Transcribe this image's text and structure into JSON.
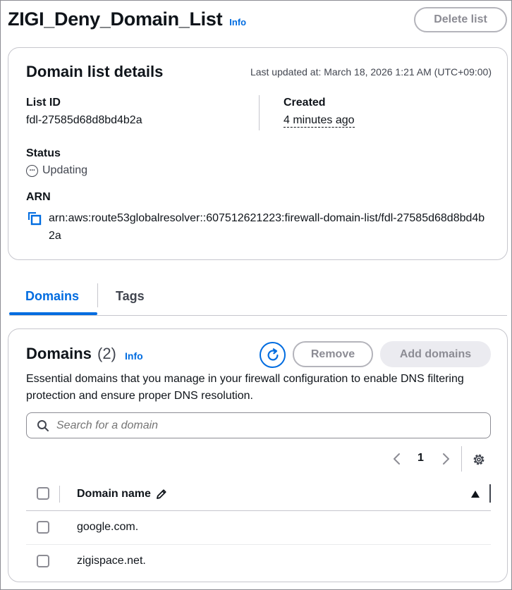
{
  "header": {
    "title": "ZIGI_Deny_Domain_List",
    "info_label": "Info",
    "delete_label": "Delete list"
  },
  "details": {
    "title": "Domain list details",
    "last_updated": "Last updated at: March 18, 2026 1:21 AM (UTC+09:00)",
    "list_id_label": "List ID",
    "list_id_value": "fdl-27585d68d8bd4b2a",
    "created_label": "Created",
    "created_value": "4 minutes ago",
    "status_label": "Status",
    "status_value": "Updating",
    "status_icon": "ellipsis-circle-icon",
    "arn_label": "ARN",
    "arn_value": "arn:aws:route53globalresolver::607512621223:firewall-domain-list/fdl-27585d68d8bd4b2a"
  },
  "tabs": [
    {
      "label": "Domains",
      "active": true
    },
    {
      "label": "Tags",
      "active": false
    }
  ],
  "domains": {
    "title": "Domains",
    "count": "(2)",
    "info_label": "Info",
    "remove_label": "Remove",
    "add_label": "Add domains",
    "description": "Essential domains that you manage in your firewall configuration to enable DNS filtering protection and ensure proper DNS resolution.",
    "search_placeholder": "Search for a domain",
    "page": "1",
    "column_header": "Domain name",
    "rows": [
      "google.com.",
      "zigispace.net."
    ]
  },
  "colors": {
    "accent": "#006ce0",
    "disabled": "#8c8c94",
    "border": "#c6c6cd"
  }
}
